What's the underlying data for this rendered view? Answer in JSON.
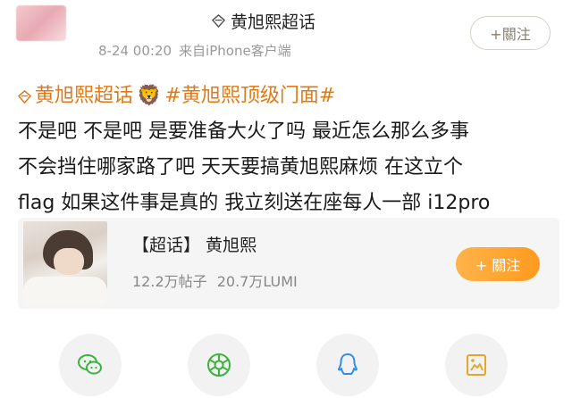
{
  "header": {
    "topic": "黄旭熙超话",
    "time": "8-24 00:20",
    "source": "来自iPhone客户端",
    "follow_label": "+關注"
  },
  "post": {
    "topic_tag": "黄旭熙超话",
    "hashtag": "#黄旭熙顶级门面#",
    "lines": [
      "不是吧 不是吧 是要准备大火了吗 最近怎么那么多事",
      "不会挡住哪家路了吧 天天要搞黄旭熙麻烦 在这立个",
      "flag 如果这件事是真的 我立刻送在座每人一部 i12pro"
    ]
  },
  "card": {
    "title": "【超话】 黄旭熙",
    "posts": "12.2万帖子",
    "fans": "20.7万LUMI",
    "follow_label": "+ 關注"
  },
  "share": [
    "wechat-icon",
    "moments-icon",
    "qq-icon",
    "qzone-icon"
  ],
  "colors": {
    "accent": "#ff9a1f",
    "topic": "#e07a17",
    "share_green": "#3bb33e",
    "share_blue": "#2f8fe6",
    "share_yellow": "#e3a82b"
  }
}
